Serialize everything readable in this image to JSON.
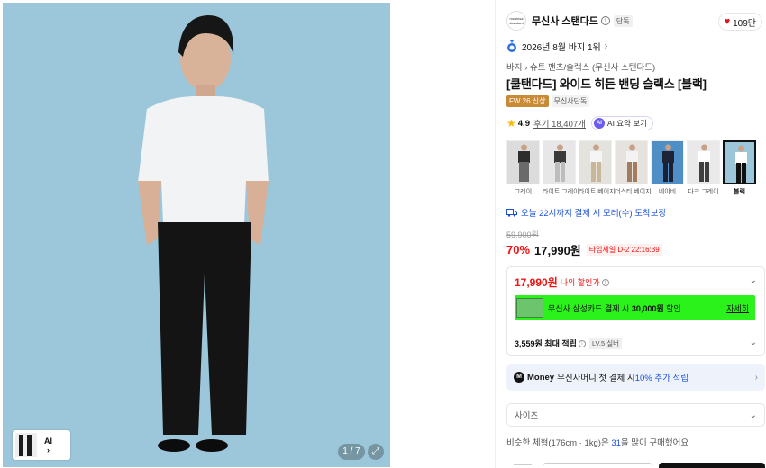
{
  "hero": {
    "pager": "1 / 7",
    "thumb_ai_label": "AI",
    "thumb_ai_arrow": "›",
    "bg_color": "#9cc7da"
  },
  "brand": {
    "logo_text": "musinsa standard",
    "name": "무신사 스탠다드",
    "exclusive": "단독",
    "likes": "109만"
  },
  "rank": {
    "text": "2026년 8월 바지 1위"
  },
  "breadcrumb": "바지 › 슈트 팬츠/슬랙스 (무신사 스탠다드)",
  "product": {
    "title": "[쿨탠다드] 와이드 히든 밴딩 슬랙스 [블랙]",
    "tag_new": "FW 26 신상",
    "tag_exclusive": "무신사단독"
  },
  "rating": {
    "score": "4.9",
    "reviews": "후기 18,407개",
    "ai_summary": "AI 요약 보기"
  },
  "colors": [
    {
      "label": "그레이",
      "shirt": "#2d2d2d",
      "pants": "#6a6a6a",
      "bg": "#dcdcdc"
    },
    {
      "label": "라이트 그레이",
      "shirt": "#3a3a3a",
      "pants": "#bdbdbd",
      "bg": "#e7e7e7"
    },
    {
      "label": "라이트 베이지",
      "shirt": "#f5f5f5",
      "pants": "#c9b79b",
      "bg": "#e4e2dc"
    },
    {
      "label": "더스티 베이지",
      "shirt": "#f3f3f3",
      "pants": "#a17c61",
      "bg": "#e6e2dd"
    },
    {
      "label": "네이비",
      "shirt": "#1d2436",
      "pants": "#1b2133",
      "bg": "#4f8fc6"
    },
    {
      "label": "다크 그레이",
      "shirt": "#ffffff",
      "pants": "#3f3f3f",
      "bg": "#e9e9e9"
    },
    {
      "label": "블랙",
      "shirt": "#ffffff",
      "pants": "#111111",
      "bg": "#9cc7da"
    }
  ],
  "delivery": "오늘 22시까지 결제 시 모레(수) 도착보장",
  "pricing": {
    "original": "59,900원",
    "discount": "70%",
    "price": "17,990원",
    "timesale": "타임세일 D-2 22:16:39"
  },
  "my_price": {
    "amount": "17,990원",
    "label": "나의 할인가",
    "card_text_pre": "무신사 삼성카드 결제 시 ",
    "card_amount": "30,000원",
    "card_text_post": " 할인",
    "card_detail": "자세히",
    "points_amount": "3,559원 최대 적립",
    "level": "LV.5 실버"
  },
  "money": {
    "brand": "Money",
    "text_pre": "무신사머니 첫 결제 시 ",
    "highlight": "10% 추가 적립"
  },
  "size_select": {
    "placeholder": "사이즈"
  },
  "similar": {
    "pre": "비슷한 체형(176cm · 1kg)은 ",
    "num": "31",
    "post": "을 많이 구매했어요"
  },
  "accent_colors": {
    "sale_red": "#f31110",
    "link_blue": "#1a4fd8",
    "card_green": "#2cf21b"
  }
}
